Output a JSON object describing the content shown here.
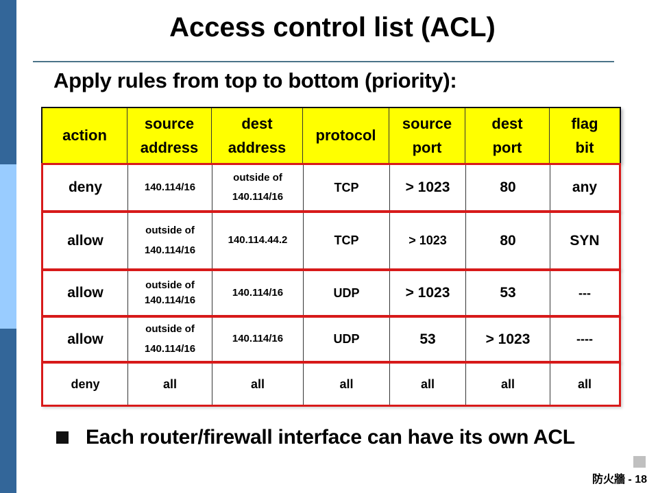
{
  "slide": {
    "title": "Access control list (ACL)",
    "subtitle": "Apply rules from top to bottom (priority):",
    "bullet": "Each router/firewall interface can have its own ACL",
    "footer": "防火牆 - 18",
    "colors": {
      "side_dark": "#336699",
      "side_light": "#99ccff",
      "header_fill": "#ffff00",
      "rule_border": "#d81a1a",
      "divider": "#4a7388"
    }
  },
  "acl": {
    "columns": [
      "action",
      "source\naddress",
      "dest\naddress",
      "protocol",
      "source\nport",
      "dest\nport",
      "flag\nbit"
    ],
    "rules": [
      [
        "deny",
        "140.114/16",
        "outside of\n140.114/16",
        "TCP",
        "> 1023",
        "80",
        "any"
      ],
      [
        "allow",
        "outside of\n140.114/16",
        "140.114.44.2",
        "TCP",
        "> 1023",
        "80",
        "SYN"
      ],
      [
        "allow",
        "outside of\n140.114/16",
        "140.114/16",
        "UDP",
        "> 1023",
        "53",
        "---"
      ],
      [
        "allow",
        "outside of\n140.114/16",
        "140.114/16",
        "UDP",
        "53",
        "> 1023",
        "----"
      ],
      [
        "deny",
        "all",
        "all",
        "all",
        "all",
        "all",
        "all"
      ]
    ]
  }
}
